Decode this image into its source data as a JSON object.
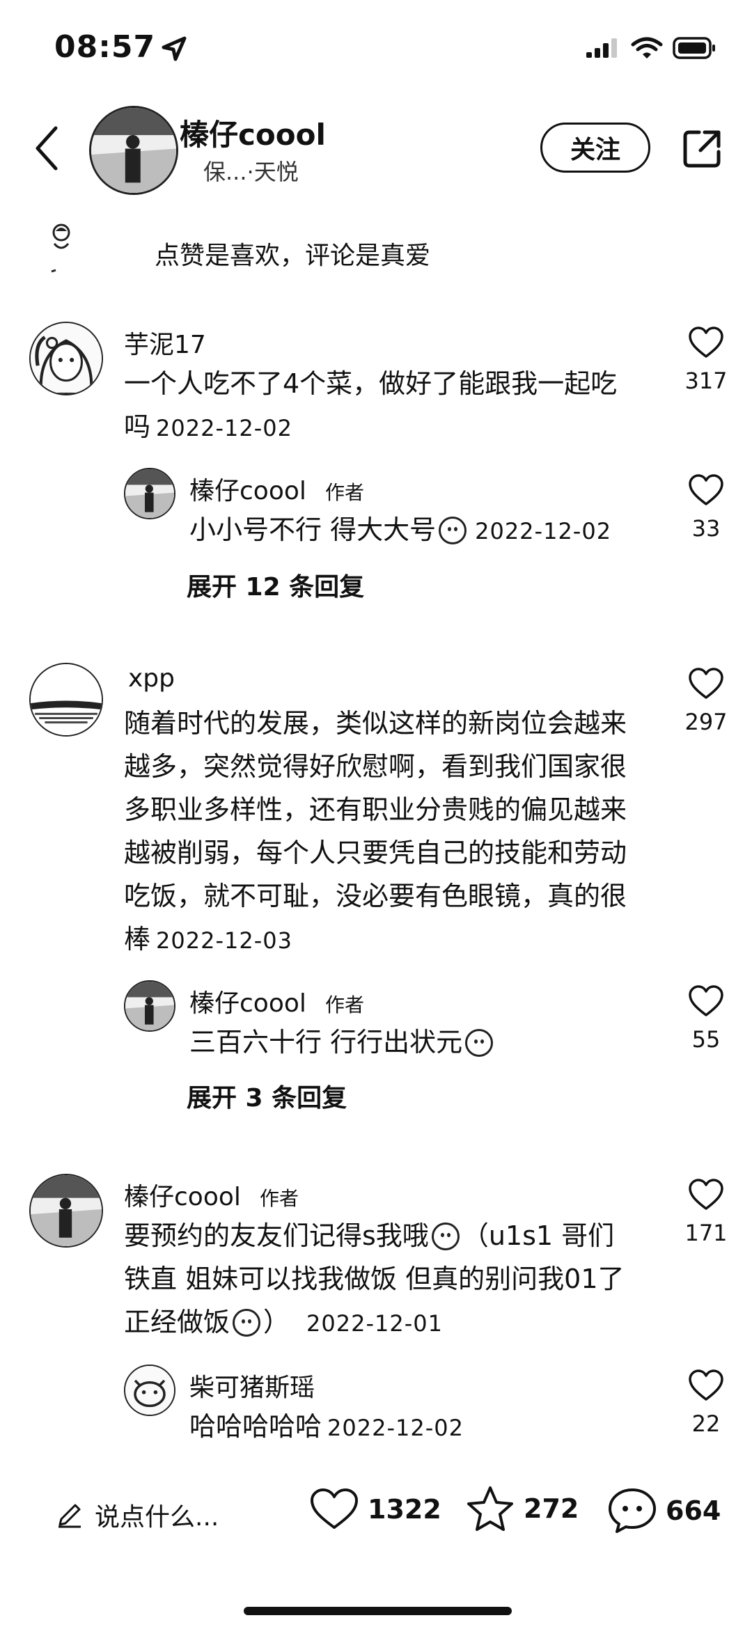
{
  "status_bar": {
    "time": "08:57"
  },
  "header": {
    "name": "榛仔coool",
    "subtitle": "保...·天悦",
    "follow_label": "关注"
  },
  "slogan": "点赞是喜欢，评论是真爱",
  "comments": [
    {
      "name": "芋泥17",
      "text": "一个人吃不了4个菜，做好了能跟我一起吃吗",
      "text_line1": "一个人吃不了4个菜，做好了能跟我一起吃",
      "text_line2": "吗",
      "date": "2022-12-02",
      "likes": "317",
      "reply": {
        "name": "榛仔coool",
        "tag": "作者",
        "text": "小小号不行 得大大号",
        "date": "2022-12-02",
        "likes": "33"
      },
      "expand": "展开 12 条回复"
    },
    {
      "name": "xpp",
      "text_lines": [
        "随着时代的发展，类似这样的新岗位会越来",
        "越多，突然觉得好欣慰啊，看到我们国家很",
        "多职业多样性，还有职业分贵贱的偏见越来",
        "越被削弱，每个人只要凭自己的技能和劳动",
        "吃饭，就不可耻，没必要有色眼镜，真的很",
        "棒"
      ],
      "date": "2022-12-03",
      "likes": "297",
      "reply": {
        "name": "榛仔coool",
        "tag": "作者",
        "text": "三百六十行 行行出状元",
        "likes": "55"
      },
      "expand": "展开 3 条回复"
    },
    {
      "name": "榛仔coool",
      "tag": "作者",
      "text_line1": "要预约的友友们记得s我哦",
      "text_line1b": "（u1s1 哥们",
      "text_line2": "铁直 姐妹可以找我做饭 但真的别问我01了",
      "text_line3": "正经做饭",
      "text_line3b": "）",
      "date": "2022-12-01",
      "likes": "171",
      "reply": {
        "name": "柴可猪斯瑶",
        "text": "哈哈哈哈哈",
        "date": "2022-12-02",
        "likes": "22"
      }
    }
  ],
  "bottom_bar": {
    "input_placeholder": "说点什么...",
    "likes": "1322",
    "stars": "272",
    "comments": "664"
  }
}
